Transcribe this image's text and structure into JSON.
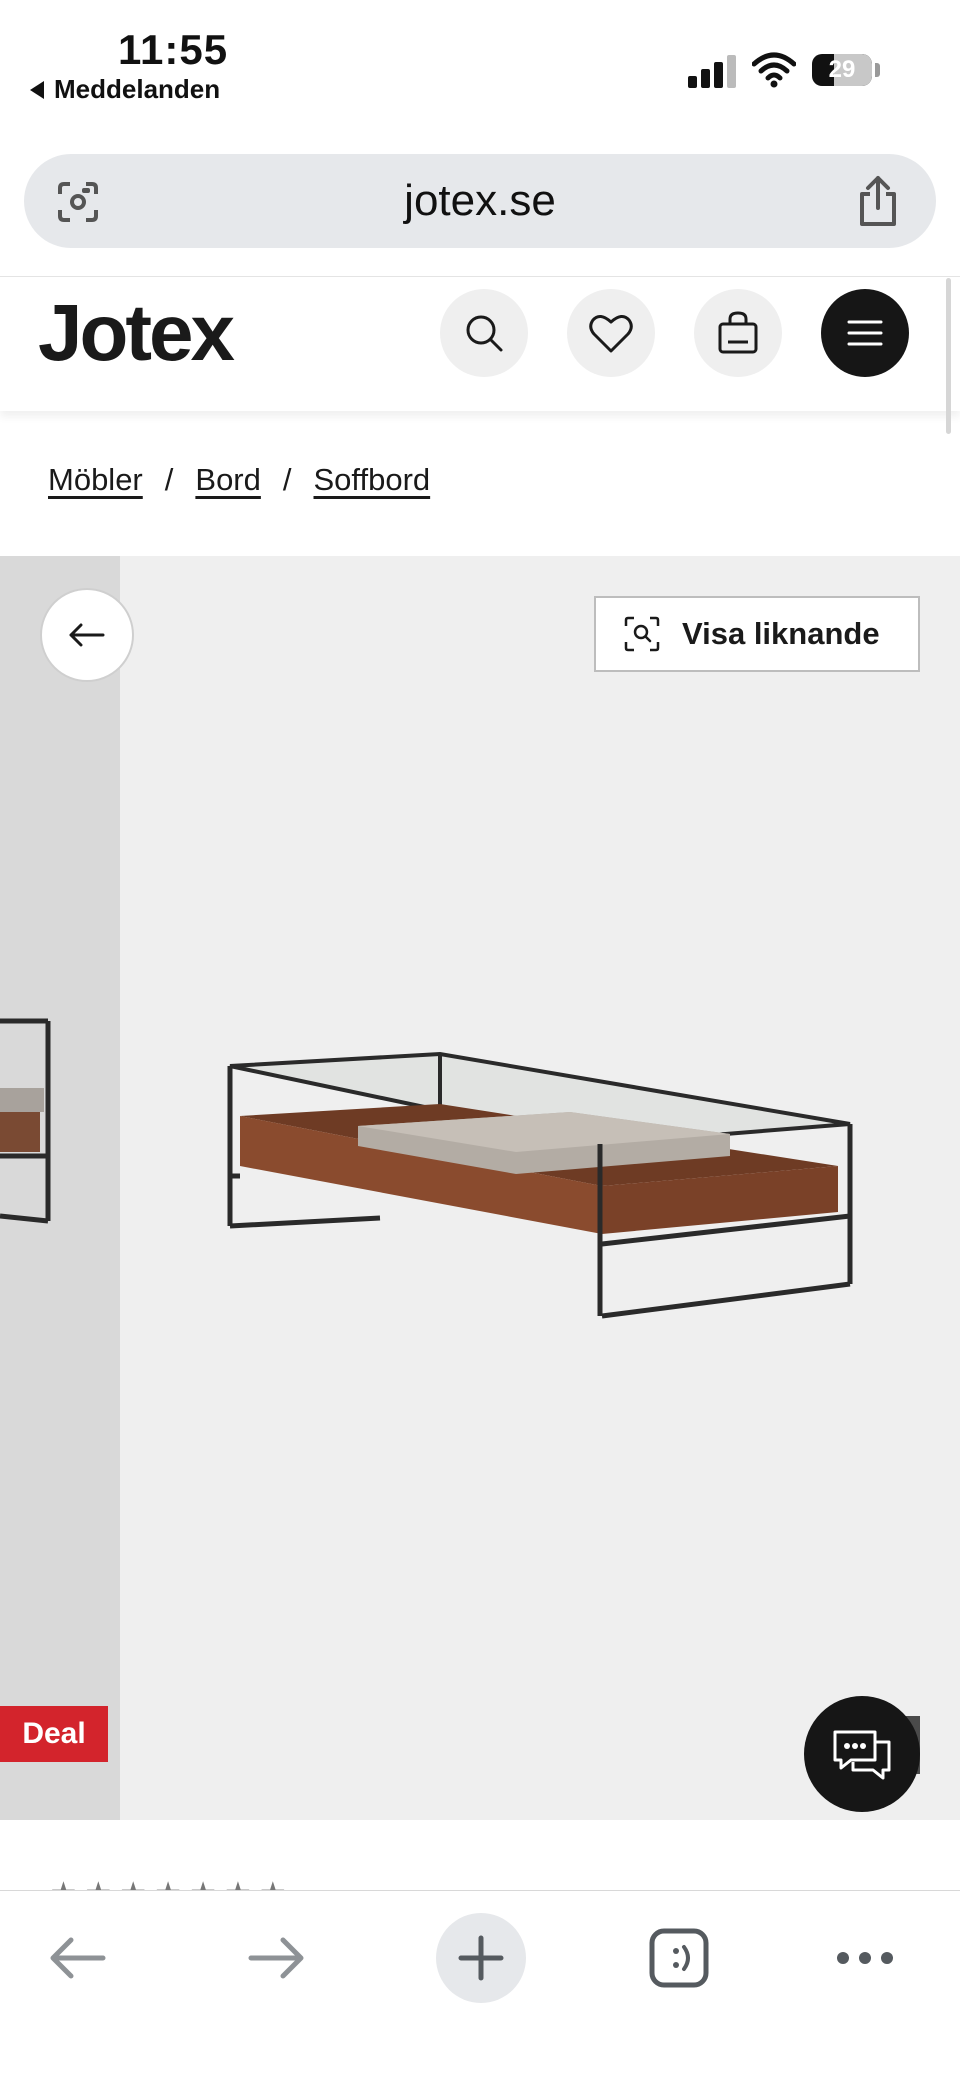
{
  "status_bar": {
    "time": "11:55",
    "back_app": "Meddelanden",
    "battery_level": "29"
  },
  "address_bar": {
    "url": "jotex.se"
  },
  "site_header": {
    "logo": "Jotex"
  },
  "breadcrumb": {
    "items": [
      "Möbler",
      "Bord",
      "Soffbord"
    ],
    "separator": "/"
  },
  "gallery": {
    "similar_label": "Visa liknande",
    "deal_badge": "Deal"
  },
  "colors": {
    "deal": "#d3242c",
    "dark": "#161616",
    "gallery_bg": "#efefef"
  },
  "icons": {
    "address_left": "lens-icon",
    "address_right": "share-icon",
    "header": [
      "search-icon",
      "heart-icon",
      "bag-icon",
      "menu-icon"
    ],
    "toolbar": [
      "back-arrow-icon",
      "forward-arrow-icon",
      "plus-icon",
      "tabs-icon",
      "more-icon"
    ]
  }
}
